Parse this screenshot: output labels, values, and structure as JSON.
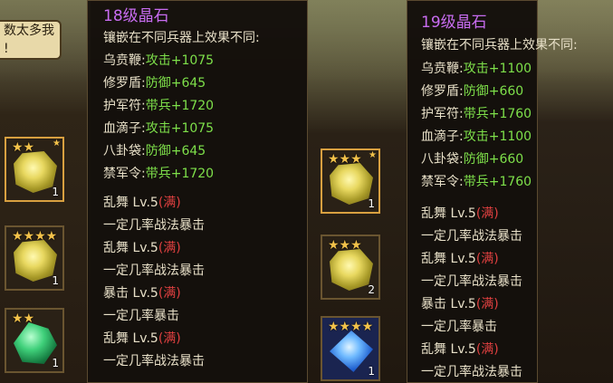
{
  "notice": {
    "line1": "数太多我",
    "line2": "!"
  },
  "left_slots": [
    {
      "stars": "★★",
      "count": "1",
      "gem": "yellow",
      "selected": true
    },
    {
      "stars": "★★★★",
      "count": "1",
      "gem": "yellow",
      "selected": false
    },
    {
      "stars": "★★",
      "count": "1",
      "gem": "green",
      "selected": false
    }
  ],
  "right_slots": [
    {
      "stars": "★★★",
      "count": "1",
      "gem": "yellow",
      "selected": true
    },
    {
      "stars": "★★★",
      "count": "2",
      "gem": "yellow",
      "selected": false
    },
    {
      "stars": "★★★★",
      "count": "1",
      "gem": "blue",
      "selected": false
    }
  ],
  "tooltip_left": {
    "title": "18级晶石",
    "subtitle": "镶嵌在不同兵器上效果不同:",
    "effects": [
      {
        "weapon": "乌贲鞭:",
        "stat": "攻击+1075"
      },
      {
        "weapon": "修罗盾:",
        "stat": "防御+645"
      },
      {
        "weapon": "护军符:",
        "stat": "带兵+1720"
      },
      {
        "weapon": "血滴子:",
        "stat": "攻击+1075"
      },
      {
        "weapon": "八卦袋:",
        "stat": "防御+645"
      },
      {
        "weapon": "禁军令:",
        "stat": "带兵+1720"
      }
    ],
    "skills": [
      {
        "name": "乱舞 Lv.5",
        "full": "(满)",
        "desc": "一定几率战法暴击"
      },
      {
        "name": "乱舞 Lv.5",
        "full": "(满)",
        "desc": "一定几率战法暴击"
      },
      {
        "name": "暴击 Lv.5",
        "full": "(满)",
        "desc": "一定几率暴击"
      },
      {
        "name": "乱舞 Lv.5",
        "full": "(满)",
        "desc": "一定几率战法暴击"
      }
    ]
  },
  "tooltip_right": {
    "title": "19级晶石",
    "subtitle": "镶嵌在不同兵器上效果不同:",
    "effects": [
      {
        "weapon": "乌贲鞭:",
        "stat": "攻击+1100"
      },
      {
        "weapon": "修罗盾:",
        "stat": "防御+660"
      },
      {
        "weapon": "护军符:",
        "stat": "带兵+1760"
      },
      {
        "weapon": "血滴子:",
        "stat": "攻击+1100"
      },
      {
        "weapon": "八卦袋:",
        "stat": "防御+660"
      },
      {
        "weapon": "禁军令:",
        "stat": "带兵+1760"
      }
    ],
    "skills": [
      {
        "name": "乱舞 Lv.5",
        "full": "(满)",
        "desc": "一定几率战法暴击"
      },
      {
        "name": "乱舞 Lv.5",
        "full": "(满)",
        "desc": "一定几率战法暴击"
      },
      {
        "name": "暴击 Lv.5",
        "full": "(满)",
        "desc": "一定几率暴击"
      },
      {
        "name": "乱舞 Lv.5",
        "full": "(满)",
        "desc": "一定几率战法暴击"
      }
    ]
  }
}
